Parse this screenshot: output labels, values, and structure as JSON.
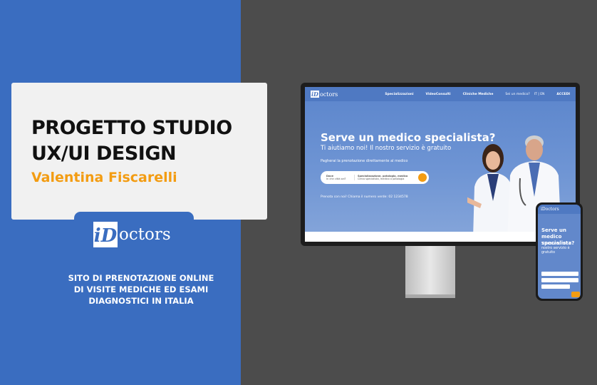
{
  "card": {
    "line1": "PROGETTO STUDIO",
    "line2": "UX/UI DESIGN",
    "author": "Valentina Fiscarelli"
  },
  "logo": {
    "initial": "i",
    "d": "D",
    "rest": "octors"
  },
  "tagline": {
    "line1": "SITO DI PRENOTAZIONE ONLINE",
    "line2": "DI VISITE MEDICHE ED ESAMI",
    "line3": "DIAGNOSTICI IN ITALIA"
  },
  "desktop": {
    "nav": {
      "brand_mark": "iD",
      "brand_rest": "octors",
      "items": [
        "Specializzazioni",
        "VideoConsulti",
        "Cliniche Mediche",
        "Sei un medico?",
        "IT | EN",
        "ACCEDI"
      ]
    },
    "hero_title": "Serve un medico specialista?",
    "hero_sub": "Ti aiutiamo noi! Il nostro servizio è gratuito",
    "hero_pay": "Pagherai la prenotazione direttamente al medico",
    "search_where_label": "Dove",
    "search_where_placeholder": "In che città sei?",
    "search_spec_label": "Specializzazione, patologia, medico",
    "search_spec_placeholder": "Cerca specialista, medico o patologia",
    "phone_line": "Prenota con noi! Chiama il numero verde: 02 1234578"
  },
  "mobile": {
    "brand": "iDoctors",
    "title": "Serve un medico specialista?",
    "sub": "Ti aiutiamo noi! Il nostro servizio è gratuito"
  },
  "colors": {
    "blue": "#3a6dc0",
    "orange": "#f39c12",
    "dark": "#4c4c4c"
  }
}
